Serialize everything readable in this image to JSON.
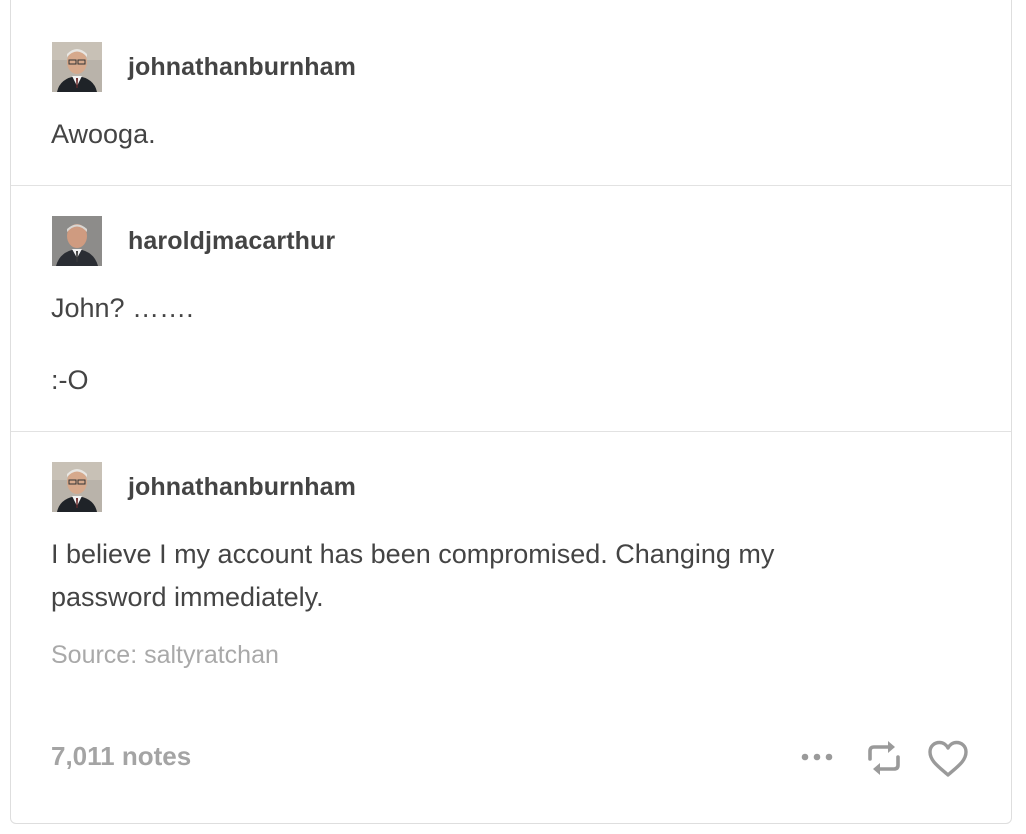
{
  "post": {
    "reblogs": [
      {
        "username": "johnathanburnham",
        "paragraphs": [
          "Awooga."
        ]
      },
      {
        "username": "haroldjmacarthur",
        "paragraphs": [
          "John? …….",
          ":-O"
        ]
      },
      {
        "username": "johnathanburnham",
        "paragraphs": [
          "I believe I my account has been compromised. Changing my",
          "password immediately."
        ]
      }
    ],
    "source": "Source: saltyratchan",
    "notes": "7,011 notes",
    "actions": {
      "more": "ellipsis-icon",
      "reblog": "reblog-icon",
      "like": "heart-icon"
    },
    "colors": {
      "text": "#444444",
      "muted": "#a9a9a9",
      "icon": "#9a9a9a",
      "border": "#dedede"
    }
  }
}
